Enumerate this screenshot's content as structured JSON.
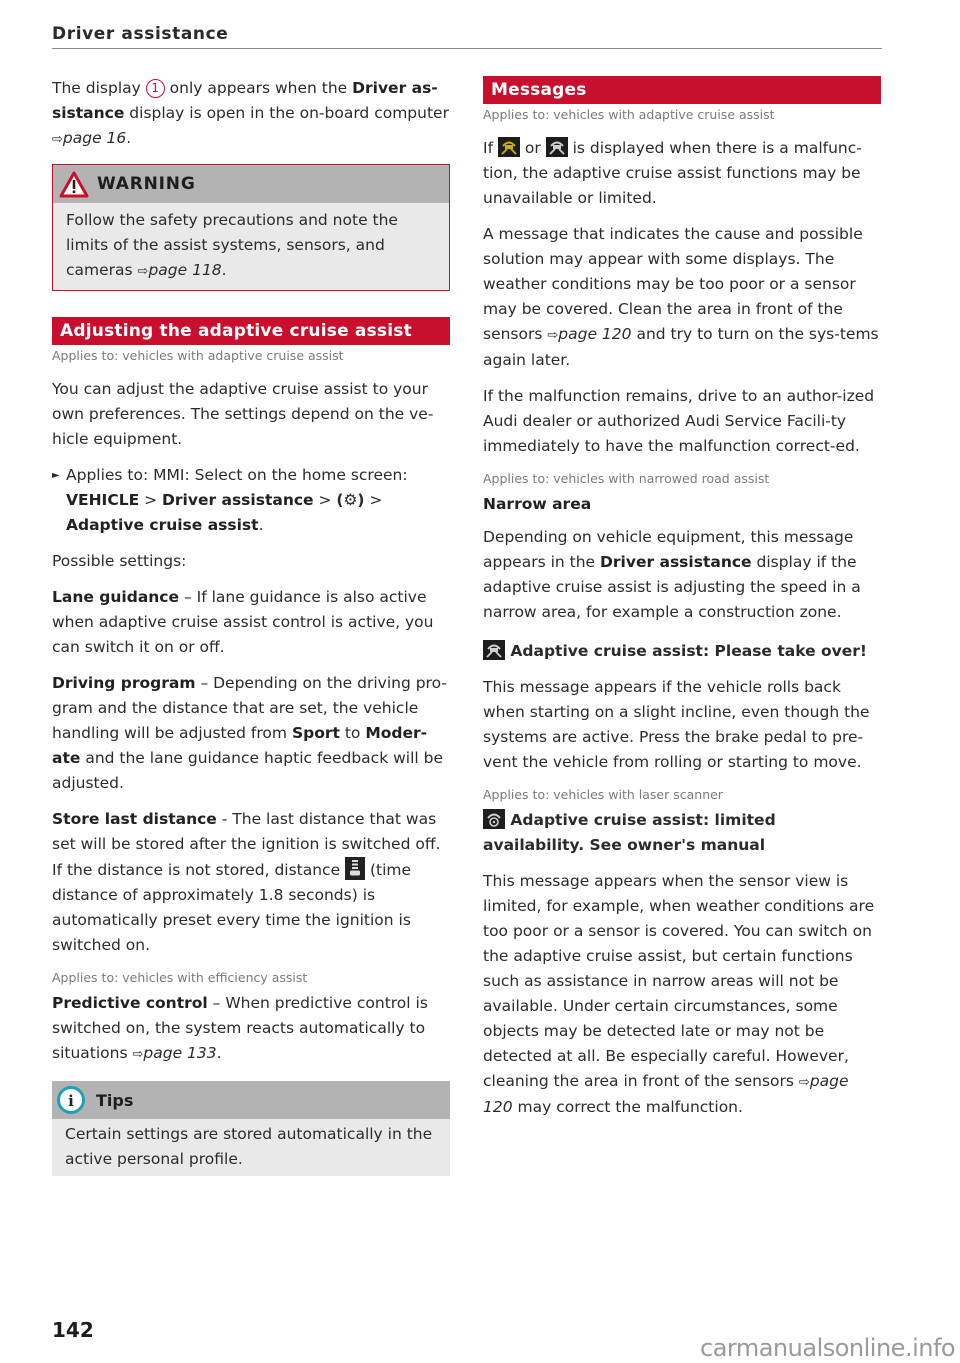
{
  "header": {
    "title": "Driver assistance"
  },
  "left": {
    "intro": {
      "pre": "The display ",
      "callout": "1",
      "mid": " only appears when the ",
      "bold": "Driver as-sistance",
      "post": " display is open in the on-board computer ",
      "xref": "page 16",
      "end": "."
    },
    "warning": {
      "label": "WARNING",
      "text": "Follow the safety precautions and note the limits of the assist systems, sensors, and cameras ",
      "xref": "page 118",
      "end": "."
    },
    "section": {
      "title": "Adjusting the adaptive cruise assist",
      "applies": "Applies to: vehicles with adaptive cruise assist",
      "intro": "You can adjust the adaptive cruise assist to your own preferences. The settings depend on the ve-hicle equipment.",
      "step": {
        "prefix": "Applies to: MMI: Select on the home screen:",
        "path1": "VEHICLE",
        "sep": " > ",
        "path2": "Driver assistance",
        "gear": "(⚙)",
        "path3": "Adaptive cruise assist",
        "end": "."
      },
      "possible": "Possible settings:",
      "settings": [
        {
          "name": "Lane guidance",
          "text": " – If lane guidance is also active when adaptive cruise assist control is active, you can switch it on or off."
        },
        {
          "name": "Driving program",
          "text_a": " – Depending on the driving pro-gram and the distance that are set, the vehicle handling will be adjusted from ",
          "sport": "Sport",
          "to": " to ",
          "moderate": "Moder-ate",
          "text_b": " and the lane guidance haptic feedback will be adjusted."
        },
        {
          "name": "Store last distance",
          "text_a": " - The last distance that was set will be stored after the ignition is switched off. If the distance is not stored, distance ",
          "text_b": " (time distance of approximately 1.8 seconds) is automatically preset every time the ignition is switched on."
        }
      ],
      "applies_efficiency": "Applies to: vehicles with efficiency assist",
      "predictive": {
        "name": "Predictive control",
        "text": " – When predictive control is switched on, the system reacts automatically to situations ",
        "xref": "page 133",
        "end": "."
      }
    },
    "tips": {
      "label": "Tips",
      "text": "Certain settings are stored automatically in the active personal profile."
    }
  },
  "right": {
    "section": {
      "title": "Messages",
      "applies": "Applies to: vehicles with adaptive cruise assist",
      "p1_a": "If ",
      "p1_or": " or ",
      "p1_b": " is displayed when there is a malfunc-tion, the adaptive cruise assist functions may be unavailable or limited.",
      "p2": "A message that indicates the cause and possible solution may appear with some displays. The weather conditions may be too poor or a sensor may be covered. Clean the area in front of the sensors ",
      "p2_xref": "page 120",
      "p2_end": " and try to turn on the sys-tems again later.",
      "p3": "If the malfunction remains, drive to an author-ized Audi dealer or authorized Audi Service Facili-ty immediately to have the malfunction correct-ed.",
      "applies_narrow": "Applies to: vehicles with narrowed road assist",
      "narrow_title": "Narrow area",
      "narrow_a": "Depending on vehicle equipment, this message appears in the ",
      "narrow_bold": "Driver assistance",
      "narrow_b": " display if the adaptive cruise assist is adjusting the speed in a narrow area, for example a construction zone.",
      "msg1_title": "Adaptive cruise assist: Please take over!",
      "msg1_text": "This message appears if the vehicle rolls back when starting on a slight incline, even though the systems are active. Press the brake pedal to pre-vent the vehicle from rolling or starting to move.",
      "applies_laser": "Applies to: vehicles with laser scanner",
      "msg2_title": "Adaptive cruise assist: limited availability. See owner's manual",
      "msg2_text": "This message appears when the sensor view is limited, for example, when weather conditions are too poor or a sensor is covered. You can switch on the adaptive cruise assist, but certain functions such as assistance in narrow areas will not be available. Under certain circumstances, some objects may be detected late or may not be detected at all. Be especially careful. However, cleaning the area in front of the sensors ",
      "msg2_xref": "page 120",
      "msg2_end": " may correct the malfunction."
    }
  },
  "icons": {
    "arrow": "⇨",
    "bullet": "►"
  },
  "colors": {
    "accent": "#c8102e",
    "box_header": "#b3b3b3",
    "box_body": "#e9e9e9",
    "warning_yellow": "#c9b400"
  },
  "footer": {
    "page_number": "142",
    "watermark": "carmanualsonline.info"
  }
}
